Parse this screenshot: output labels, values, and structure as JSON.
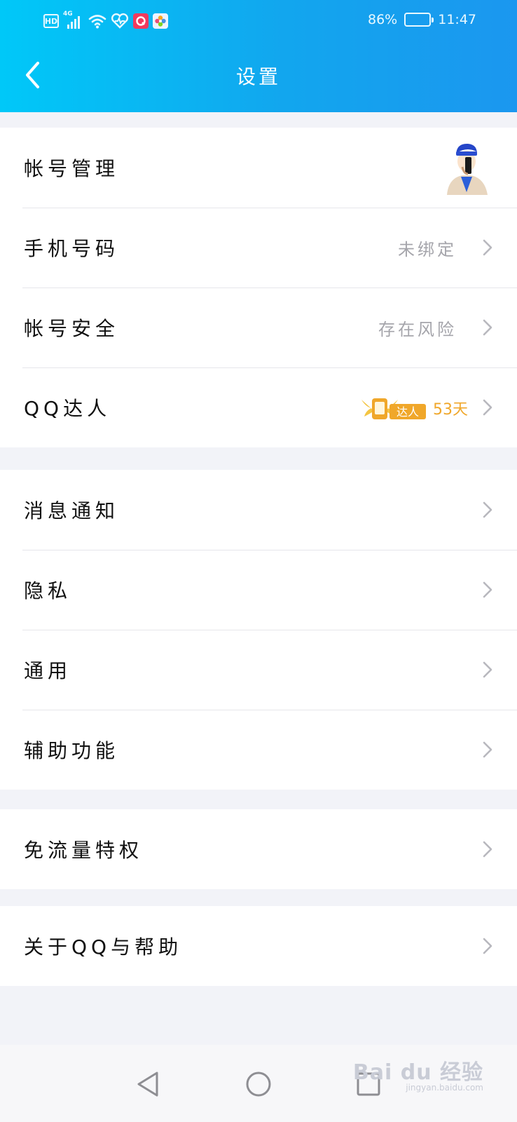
{
  "status_bar": {
    "hd": "HD",
    "network": "4G",
    "battery": "86%",
    "battery_level": 0.86,
    "time": "11:47",
    "icons": [
      "signal-icon",
      "wifi-icon",
      "health-icon",
      "app-icon-red",
      "app-icon-flower"
    ]
  },
  "header": {
    "title": "设置",
    "back_icon": "chevron-left-icon"
  },
  "groups": [
    {
      "rows": [
        {
          "label": "帐号管理",
          "value": "",
          "accessory": "avatar"
        },
        {
          "label": "手机号码",
          "value": "未绑定"
        },
        {
          "label": "帐号安全",
          "value": "存在风险"
        },
        {
          "label": "QQ达人",
          "badge": "达人",
          "value": "53天",
          "value_color": "#f0a72a"
        }
      ]
    },
    {
      "rows": [
        {
          "label": "消息通知"
        },
        {
          "label": "隐私"
        },
        {
          "label": "通用"
        },
        {
          "label": "辅助功能"
        }
      ]
    },
    {
      "rows": [
        {
          "label": "免流量特权"
        }
      ]
    },
    {
      "rows": [
        {
          "label": "关于QQ与帮助"
        }
      ]
    }
  ],
  "watermark": {
    "brand": "Bai du 经验",
    "url": "jingyan.baidu.com"
  },
  "colors": {
    "header_gradient_start": "#00c8f8",
    "header_gradient_end": "#1b97ef",
    "page_background": "#f2f3f8",
    "secondary_text": "#a5a5ab",
    "talent_orange": "#f0a72a"
  }
}
